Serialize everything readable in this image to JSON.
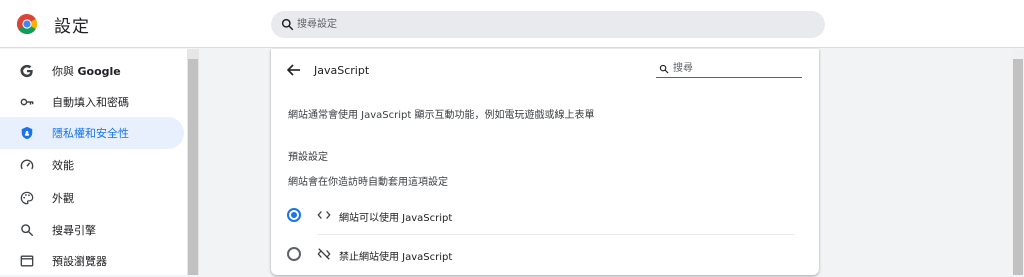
{
  "app": {
    "title": "設定",
    "search_placeholder": "搜尋設定"
  },
  "sidebar": {
    "items": [
      {
        "label_prefix": "你與 ",
        "label_bold": "Google",
        "icon": "google-g-icon"
      },
      {
        "label": "自動填入和密碼",
        "icon": "key-icon"
      },
      {
        "label": "隱私權和安全性",
        "icon": "shield-icon",
        "active": true
      },
      {
        "label": "效能",
        "icon": "speedometer-icon"
      },
      {
        "label": "外觀",
        "icon": "palette-icon"
      },
      {
        "label": "搜尋引擎",
        "icon": "search-icon"
      },
      {
        "label": "預設瀏覽器",
        "icon": "browser-window-icon"
      }
    ]
  },
  "content": {
    "title": "JavaScript",
    "search_placeholder": "搜尋",
    "description": "網站通常會使用 JavaScript 顯示互動功能，例如電玩遊戲或線上表單",
    "default_section": {
      "title": "預設設定",
      "subtitle": "網站會在你造訪時自動套用這項設定"
    },
    "options": [
      {
        "label": "網站可以使用 JavaScript",
        "icon": "code-icon",
        "checked": true
      },
      {
        "label": "禁止網站使用 JavaScript",
        "icon": "code-off-icon",
        "checked": false
      }
    ]
  },
  "colors": {
    "accent": "#1a73e8",
    "active_bg": "#e8f0fe",
    "page_bg": "#f1f3f4"
  }
}
